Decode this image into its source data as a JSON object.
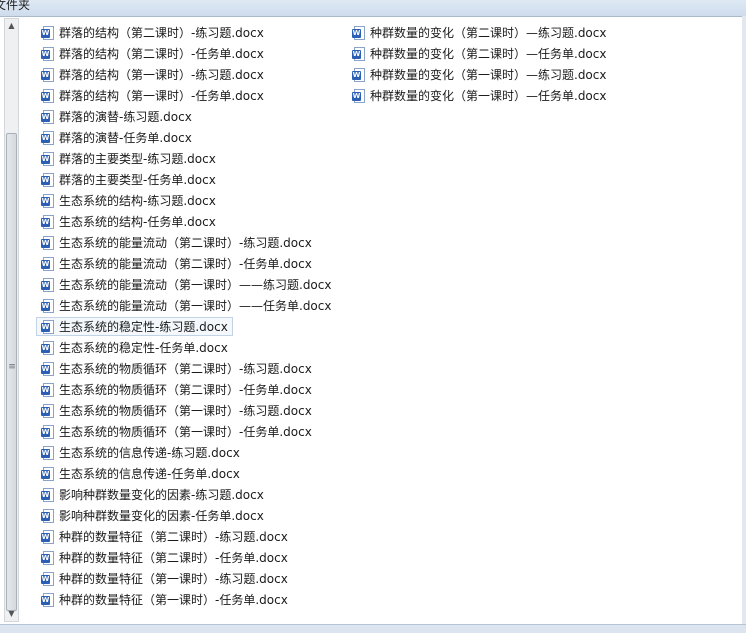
{
  "window": {
    "title_partial": "文件夹"
  },
  "icons": {
    "file_icon": "word-document-icon",
    "badge_letter": "W",
    "badge_color": "#2b5fb3"
  },
  "files": [
    {
      "name": "群落的结构（第二课时）-练习题.docx"
    },
    {
      "name": "群落的结构（第二课时）-任务单.docx"
    },
    {
      "name": "群落的结构（第一课时）-练习题.docx"
    },
    {
      "name": "群落的结构（第一课时）-任务单.docx"
    },
    {
      "name": "群落的演替-练习题.docx"
    },
    {
      "name": "群落的演替-任务单.docx"
    },
    {
      "name": "群落的主要类型-练习题.docx"
    },
    {
      "name": "群落的主要类型-任务单.docx"
    },
    {
      "name": "生态系统的结构-练习题.docx"
    },
    {
      "name": "生态系统的结构-任务单.docx"
    },
    {
      "name": "生态系统的能量流动（第二课时）-练习题.docx"
    },
    {
      "name": "生态系统的能量流动（第二课时）-任务单.docx"
    },
    {
      "name": "生态系统的能量流动（第一课时）——练习题.docx"
    },
    {
      "name": "生态系统的能量流动（第一课时）——任务单.docx"
    },
    {
      "name": "生态系统的稳定性-练习题.docx",
      "focused": true
    },
    {
      "name": "生态系统的稳定性-任务单.docx"
    },
    {
      "name": "生态系统的物质循环（第二课时）-练习题.docx"
    },
    {
      "name": "生态系统的物质循环（第二课时）-任务单.docx"
    },
    {
      "name": "生态系统的物质循环（第一课时）-练习题.docx"
    },
    {
      "name": "生态系统的物质循环（第一课时）-任务单.docx"
    },
    {
      "name": "生态系统的信息传递-练习题.docx"
    },
    {
      "name": "生态系统的信息传递-任务单.docx"
    },
    {
      "name": "影响种群数量变化的因素-练习题.docx"
    },
    {
      "name": "影响种群数量变化的因素-任务单.docx"
    },
    {
      "name": "种群的数量特征（第二课时）-练习题.docx"
    },
    {
      "name": "种群的数量特征（第二课时）-任务单.docx"
    },
    {
      "name": "种群的数量特征（第一课时）-练习题.docx"
    },
    {
      "name": "种群的数量特征（第一课时）-任务单.docx"
    },
    {
      "name": "种群数量的变化（第二课时）—练习题.docx"
    },
    {
      "name": "种群数量的变化（第二课时）—任务单.docx"
    },
    {
      "name": "种群数量的变化（第一课时）—练习题.docx"
    },
    {
      "name": "种群数量的变化（第一课时）—任务单.docx"
    }
  ]
}
